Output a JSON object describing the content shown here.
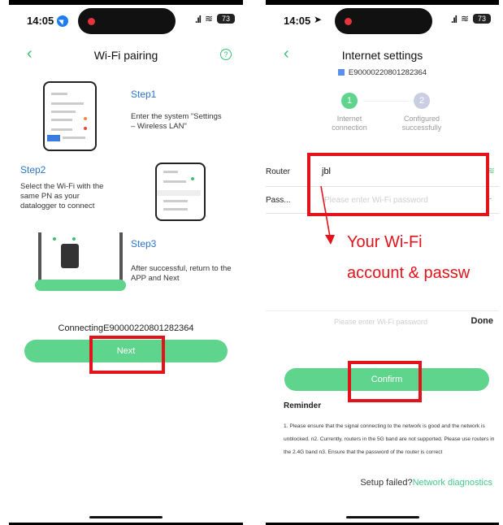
{
  "left": {
    "status": {
      "time": "14:05",
      "battery": "73"
    },
    "nav": {
      "back": "‹",
      "title": "Wi-Fi pairing",
      "help": "?"
    },
    "steps": [
      {
        "title": "Step1",
        "text": "Enter the system \"Settings – Wireless LAN\""
      },
      {
        "title": "Step2",
        "text": "Select the Wi-Fi with the same PN as your datalogger to connect"
      },
      {
        "title": "Step3",
        "text": "After successful, return to the APP and Next"
      }
    ],
    "connecting": "ConnectingE90000220801282364",
    "next_label": "Next"
  },
  "right": {
    "status": {
      "time": "14:05",
      "battery": "73"
    },
    "nav": {
      "back": "‹",
      "title": "Internet settings"
    },
    "device_id": "E90000220801282364",
    "progress": [
      {
        "num": "1",
        "label": "Internet connection",
        "color": "#5fd48c"
      },
      {
        "num": "2",
        "label": "Configured successfully",
        "color": "#c9cfe0"
      }
    ],
    "router": {
      "label": "Router",
      "value": "jbl"
    },
    "password": {
      "label": "Pass...",
      "placeholder": "Please enter Wi-Fi password"
    },
    "annotation": {
      "line1": "Your Wi-Fi",
      "line2": "account & passw"
    },
    "keyboard_bar": {
      "placeholder": "Please enter Wi-Fi password",
      "done": "Done"
    },
    "confirm_label": "Confirm",
    "reminder": {
      "title": "Reminder",
      "text": "1. Please ensure that the signal connecting to the network is good and the network is unblocked. n2. Currently, routers in the 5G band are not supported. Please use routers in the 2.4G band n3. Ensure that the password of the router is correct"
    },
    "setup_failed": "Setup failed?",
    "network_diag": "Network diagnostics"
  },
  "colors": {
    "accent": "#5fd48c",
    "annotation": "#e3131b",
    "step_title": "#2f74c9"
  }
}
